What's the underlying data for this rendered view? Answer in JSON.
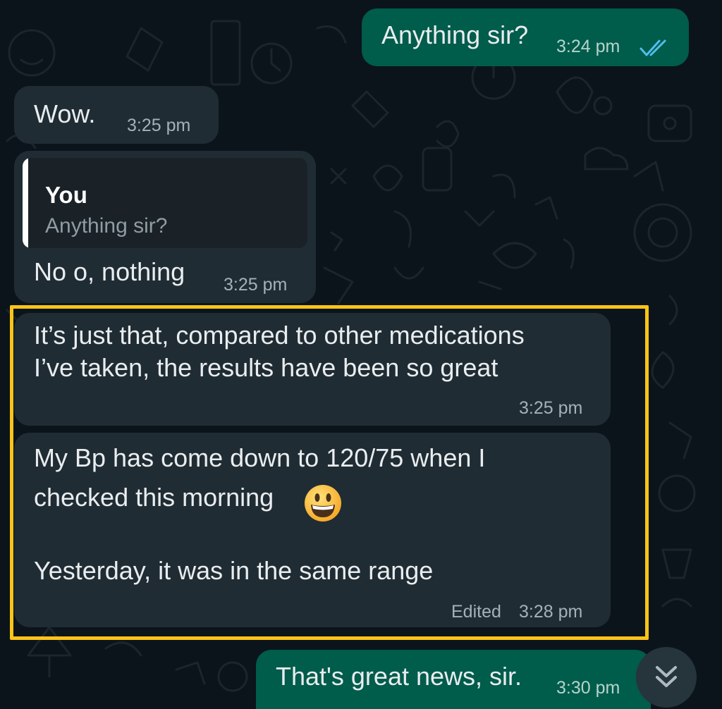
{
  "messages": [
    {
      "direction": "outgoing",
      "text": "Anything sir?",
      "time": "3:24 pm",
      "status": "read-double-tick"
    },
    {
      "direction": "incoming",
      "text": "Wow.",
      "time": "3:25 pm"
    },
    {
      "direction": "incoming",
      "reply_to": {
        "author": "You",
        "text": "Anything sir?"
      },
      "text": "No o, nothing",
      "time": "3:25 pm"
    },
    {
      "direction": "incoming",
      "text_lines": [
        "It’s just that, compared to other medications",
        "I’ve taken, the results have been so great"
      ],
      "time": "3:25 pm",
      "highlighted": true
    },
    {
      "direction": "incoming",
      "text_lines": [
        "My Bp has come down to 120/75 when I",
        "checked this morning",
        "Yesterday, it was in the same range"
      ],
      "emoji": "grinning-face",
      "edited_label": "Edited",
      "time": "3:28 pm",
      "highlighted": true
    },
    {
      "direction": "outgoing",
      "text": "That's great news, sir.",
      "time": "3:30 pm"
    }
  ],
  "colors": {
    "background": "#0b141a",
    "incoming_bubble": "#202c33",
    "outgoing_bubble": "#005c4b",
    "highlight_border": "#fcc419",
    "read_tick": "#53bdeb"
  },
  "icons": {
    "read_receipt": "double-check-icon",
    "scroll_down": "chevron-double-down-icon"
  }
}
